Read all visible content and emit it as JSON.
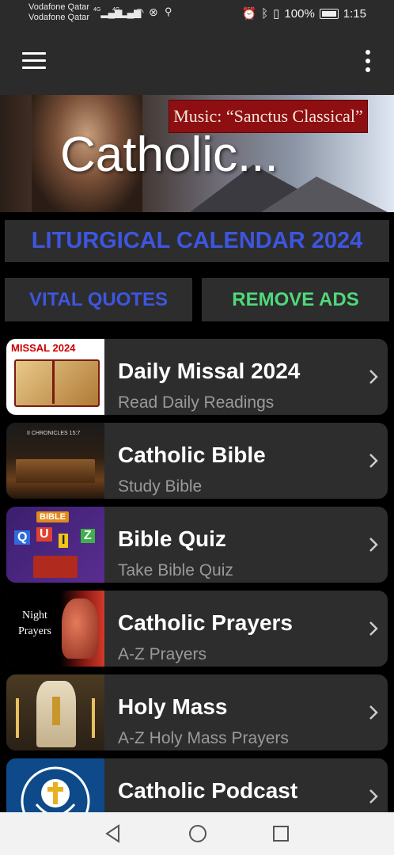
{
  "status": {
    "carrier1": "Vodafone Qatar",
    "carrier2": "Vodafone Qatar",
    "signal1": "4G",
    "signal2": "4G",
    "battery": "100%",
    "time": "1:15"
  },
  "banner": {
    "music_label": "Music: “Sanctus Classical”",
    "title": "Catholic..."
  },
  "buttons": {
    "calendar": "LITURGICAL CALENDAR 2024",
    "quotes": "VITAL QUOTES",
    "ads": "REMOVE ADS"
  },
  "items": [
    {
      "title": "Daily Missal 2024",
      "subtitle": "Read Daily Readings",
      "thumb_label": "MISSAL 2024"
    },
    {
      "title": "Catholic Bible",
      "subtitle": "Study Bible",
      "thumb_label": "II CHRONICLES 15:7"
    },
    {
      "title": "Bible Quiz",
      "subtitle": "Take Bible Quiz",
      "thumb_label": "BIBLE",
      "thumb_letters": [
        "Q",
        "U",
        "I",
        "Z"
      ]
    },
    {
      "title": "Catholic Prayers",
      "subtitle": "A-Z Prayers",
      "thumb_label": "Night Prayers"
    },
    {
      "title": "Holy Mass",
      "subtitle": "A-Z Holy Mass Prayers"
    },
    {
      "title": "Catholic Podcast",
      "subtitle": ""
    }
  ],
  "icons": {
    "menu": "hamburger-menu-icon",
    "overflow": "more-vert-icon",
    "chevron": "chevron-right-icon",
    "back": "nav-back-icon",
    "home": "nav-home-icon",
    "recents": "nav-recents-icon"
  },
  "colors": {
    "background": "#000000",
    "card": "#2d2d2d",
    "accent_blue": "#3d56e0",
    "accent_green": "#4fd97a",
    "subtitle_gray": "#9a9a9a"
  }
}
